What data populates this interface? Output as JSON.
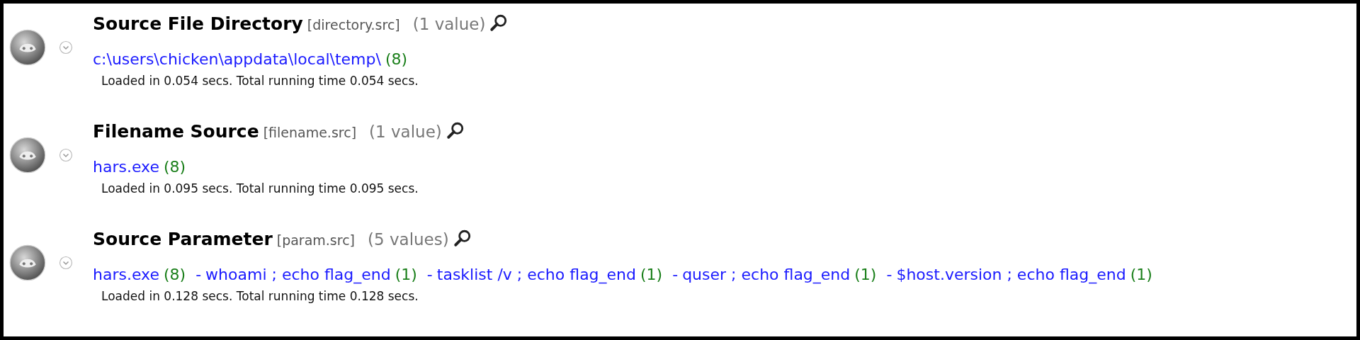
{
  "sections": [
    {
      "title": "Source File Directory",
      "key": "[directory.src]",
      "count": "(1 value)",
      "values": [
        {
          "text": "c:\\users\\chicken\\appdata\\local\\temp\\",
          "count": "(8)"
        }
      ],
      "timing": "Loaded in 0.054 secs. Total running time 0.054 secs."
    },
    {
      "title": "Filename Source",
      "key": "[filename.src]",
      "count": "(1 value)",
      "values": [
        {
          "text": "hars.exe",
          "count": "(8)"
        }
      ],
      "timing": "Loaded in 0.095 secs. Total running time 0.095 secs."
    },
    {
      "title": "Source Parameter",
      "key": "[param.src]",
      "count": "(5 values)",
      "values": [
        {
          "text": "hars.exe",
          "count": "(8)"
        },
        {
          "separator": "-",
          "text": "whoami ; echo flag_end",
          "count": "(1)"
        },
        {
          "separator": "-",
          "text": "tasklist /v ; echo flag_end",
          "count": "(1)"
        },
        {
          "separator": "-",
          "text": "quser ; echo flag_end",
          "count": "(1)"
        },
        {
          "separator": "-",
          "text": "$host.version ; echo flag_end",
          "count": "(1)"
        }
      ],
      "timing": "Loaded in 0.128 secs. Total running time 0.128 secs."
    }
  ]
}
